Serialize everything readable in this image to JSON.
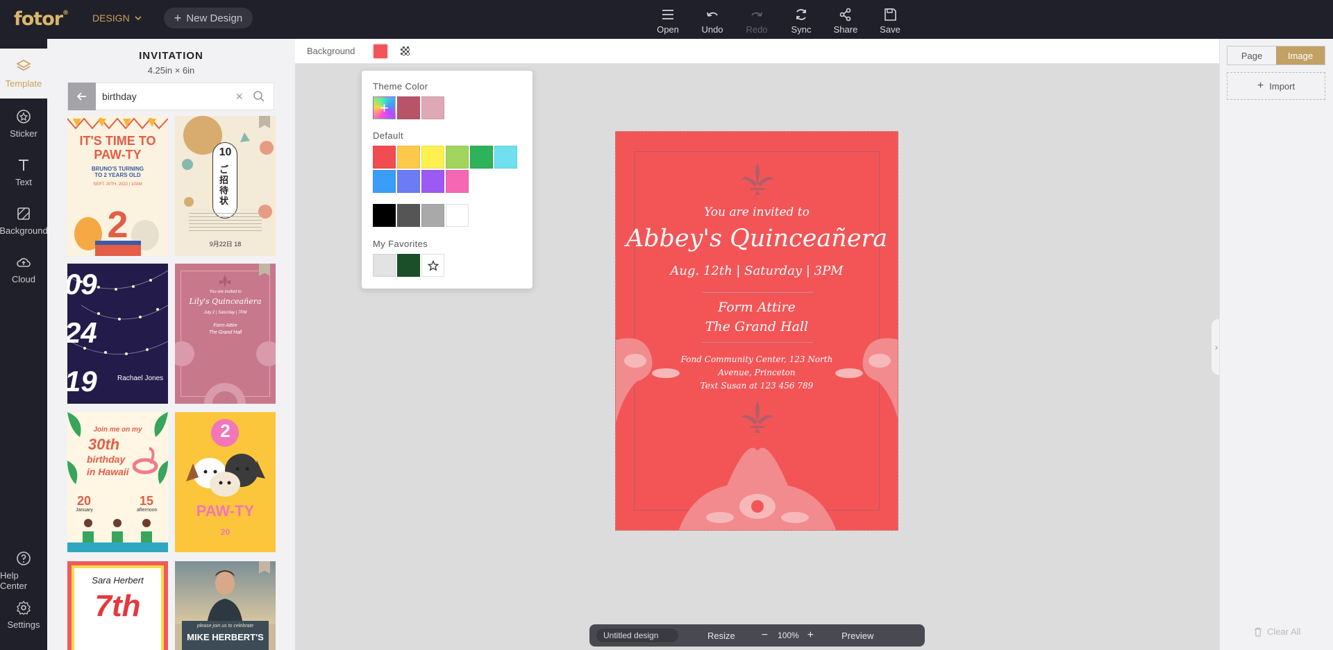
{
  "app": {
    "logo": "fotor",
    "logo_mark": "®",
    "design_menu": "DESIGN",
    "new_design": "New Design"
  },
  "toolbar": {
    "open": "Open",
    "undo": "Undo",
    "redo": "Redo",
    "sync": "Sync",
    "share": "Share",
    "save": "Save"
  },
  "rail": {
    "template": "Template",
    "sticker": "Sticker",
    "text": "Text",
    "background": "Background",
    "cloud": "Cloud",
    "help": "Help Center",
    "settings": "Settings"
  },
  "panel": {
    "title": "INVITATION",
    "size": "4.25in × 6in",
    "search_value": "birthday"
  },
  "thumbs": {
    "t1": {
      "headline": "IT'S TIME TO PAW-TY",
      "sub": "BRUNO'S TURNING TO 2 YEARS OLD",
      "date": "SEPT. 20TH, 2022 | 10AM",
      "num": "2"
    },
    "t2": {
      "badge_num": "10",
      "badge_text": "ご招待状",
      "date": "9月22日 18",
      "colors": [
        "#f3ead8",
        "#d8ac6e",
        "#e79b83",
        "#86b9ad"
      ]
    },
    "t3": {
      "lines": [
        "09",
        "24",
        "19"
      ],
      "name": "Rachael Jones"
    },
    "t4": {
      "invited": "You are invited to",
      "title": "Lily's Quinceañera",
      "date": "July 2 | Saturday | 7PM",
      "attire": "Form Attire",
      "hall": "The Grand Hall"
    },
    "t5": {
      "l1": "Join me on my",
      "l2": "30th",
      "l3": "birthday",
      "l4": "in Hawaii",
      "left_num": "20",
      "left_word": "January",
      "right_num": "15",
      "right_word": "afternoon"
    },
    "t6": {
      "badge": "2",
      "headline": "PAW-TY",
      "date_num": "20"
    },
    "t7": {
      "name": "Sara Herbert",
      "big": "7th"
    },
    "t8": {
      "sub": "please join us to celebrate",
      "headline": "MIKE HERBERT'S"
    }
  },
  "background_bar": {
    "label": "Background",
    "current_color": "#f35557"
  },
  "color_picker": {
    "theme_label": "Theme Color",
    "theme_colors": [
      "#b85468",
      "#dea8b4"
    ],
    "default_label": "Default",
    "default_colors": [
      "#f14c52",
      "#fec94b",
      "#fef14f",
      "#a2d55e",
      "#2db359",
      "#70dff0",
      "#3a9ef9",
      "#6b7cf4",
      "#9d58f6",
      "#f567b2"
    ],
    "gray_colors": [
      "#000000",
      "#555555",
      "#a9a9a9",
      "#ffffff"
    ],
    "favorites_label": "My Favorites",
    "favorite_colors": [
      "#e3e3e3",
      "#1a4f2a"
    ]
  },
  "invitation": {
    "background": "#f35557",
    "invited": "You are invited to",
    "title": "Abbey's Quinceañera",
    "date": "Aug. 12th | Saturday | 3PM",
    "attire": "Form Attire",
    "hall": "The Grand Hall",
    "address1": "Fond Community Center, 123 North",
    "address2": "Avenue, Princeton",
    "contact": "Text Susan at 123 456 789"
  },
  "right_panel": {
    "page_tab": "Page",
    "image_tab": "Image",
    "import": "Import",
    "clear_all": "Clear All"
  },
  "bottom_bar": {
    "title": "Untitled design",
    "resize": "Resize",
    "minus": "−",
    "zoom": "100%",
    "plus": "+",
    "preview": "Preview"
  }
}
